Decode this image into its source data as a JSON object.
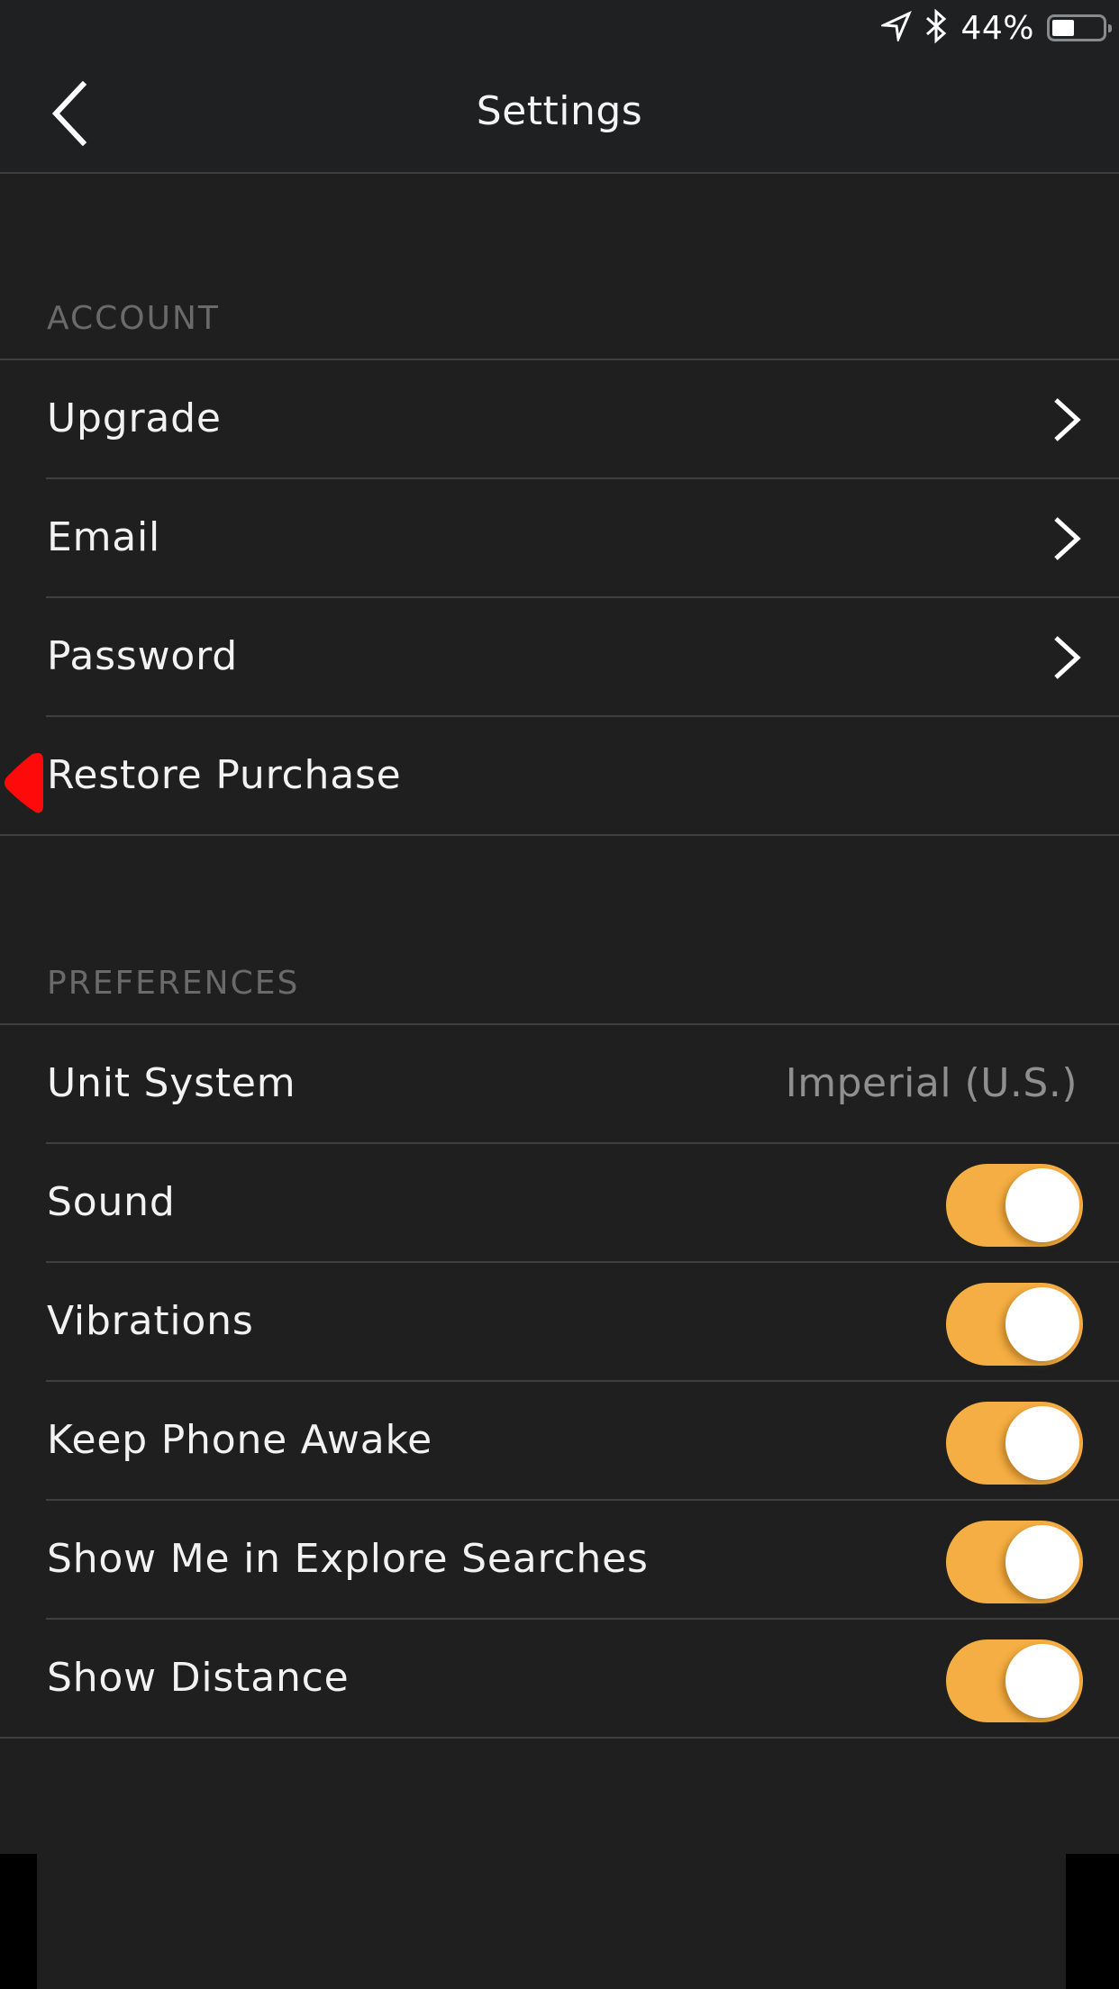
{
  "status_bar": {
    "icons": [
      "location-arrow-icon",
      "bluetooth-icon",
      "battery-icon"
    ],
    "battery_percent_label": "44%",
    "battery_level": 0.44
  },
  "nav": {
    "title": "Settings",
    "back_icon": "chevron-left-icon"
  },
  "sections": {
    "account": {
      "header": "ACCOUNT",
      "rows": [
        {
          "label": "Upgrade",
          "accessory": "chevron-right-icon"
        },
        {
          "label": "Email",
          "accessory": "chevron-right-icon"
        },
        {
          "label": "Password",
          "accessory": "chevron-right-icon"
        },
        {
          "label": "Restore Purchase",
          "accessory": "none"
        }
      ]
    },
    "preferences": {
      "header": "PREFERENCES",
      "rows": [
        {
          "label": "Unit System",
          "value": "Imperial (U.S.)"
        },
        {
          "label": "Sound",
          "toggle": true
        },
        {
          "label": "Vibrations",
          "toggle": true
        },
        {
          "label": "Keep Phone Awake",
          "toggle": true
        },
        {
          "label": "Show Me in Explore Searches",
          "toggle": true
        },
        {
          "label": "Show Distance",
          "toggle": true
        }
      ]
    }
  },
  "colors": {
    "background": "#1f1f1f",
    "toggle_on": "#f5ae43",
    "section_header": "#6a6a6a",
    "secondary_value": "#8f8f8f",
    "pointer_marker": "#ff0a0a"
  }
}
